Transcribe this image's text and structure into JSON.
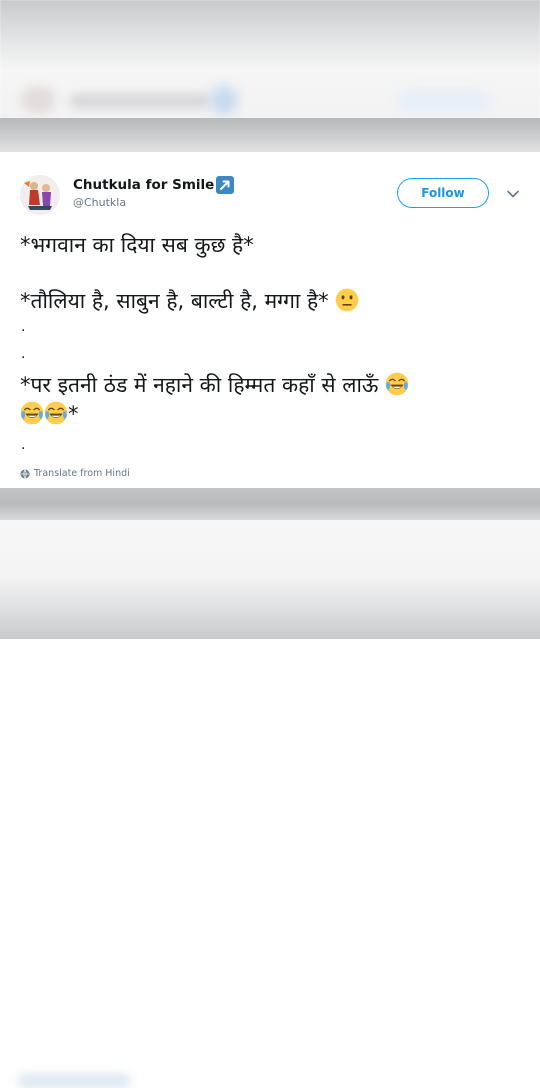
{
  "tweet": {
    "display_name": "Chutkula for Smile",
    "handle": "@Chutkla",
    "follow_label": "Follow",
    "line1": "*भगवान का दिया सब कुछ है*",
    "line2_text": "*तौलिया है, साबुन है, बाल्टी है, मग्गा है* ",
    "dot": ".",
    "line3_text": "*पर  इतनी ठंड में नहाने की हिम्मत कहाँ से लाऊँ  ",
    "line4_suffix": "*",
    "translate_label": "Translate from Hindi"
  },
  "icons": {
    "verified_link": "external-link-icon",
    "menu": "chevron-down-icon",
    "neutral_face": "neutral-face-emoji",
    "tears_of_joy": "face-with-tears-of-joy-emoji",
    "globe": "globe-icon"
  },
  "colors": {
    "accent": "#1da1f2",
    "text": "#14171a",
    "muted": "#657786",
    "emoji_yellow": "#ffcc4d"
  }
}
